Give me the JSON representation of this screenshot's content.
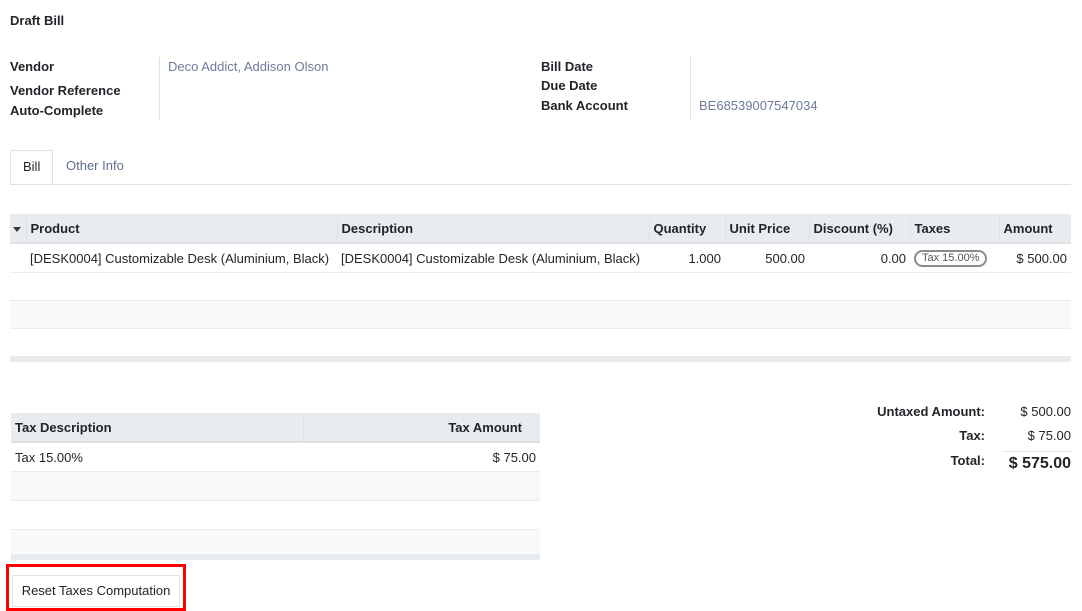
{
  "page": {
    "title": "Draft Bill"
  },
  "fields": {
    "vendor_label": "Vendor",
    "vendor_value": "Deco Addict, Addison Olson",
    "vendor_reference_label": "Vendor Reference",
    "auto_complete_label": "Auto-Complete",
    "bill_date_label": "Bill Date",
    "due_date_label": "Due Date",
    "bank_account_label": "Bank Account",
    "bank_account_value": "BE68539007547034"
  },
  "tabs": [
    {
      "label": "Bill",
      "active": true
    },
    {
      "label": "Other Info",
      "active": false
    }
  ],
  "lines_table": {
    "columns": [
      "Product",
      "Description",
      "Quantity",
      "Unit Price",
      "Discount (%)",
      "Taxes",
      "Amount"
    ],
    "rows": [
      {
        "product": "[DESK0004] Customizable Desk (Aluminium, Black)",
        "description": "[DESK0004] Customizable Desk (Aluminium, Black)",
        "quantity": "1.000",
        "unit_price": "500.00",
        "discount": "0.00",
        "taxes": "Tax 15.00%",
        "amount": "$ 500.00"
      }
    ]
  },
  "tax_table": {
    "columns": [
      "Tax Description",
      "Tax Amount"
    ],
    "rows": [
      {
        "description": "Tax 15.00%",
        "amount": "$ 75.00"
      }
    ]
  },
  "totals": {
    "untaxed_label": "Untaxed Amount:",
    "untaxed_value": "$ 500.00",
    "tax_label": "Tax:",
    "tax_value": "$ 75.00",
    "total_label": "Total:",
    "total_value": "$ 575.00"
  },
  "actions": {
    "reset_taxes_label": "Reset Taxes Computation"
  },
  "colors": {
    "link": "#6c7a9b",
    "highlight": "#ff0000",
    "header_bg": "#e9ecef"
  }
}
